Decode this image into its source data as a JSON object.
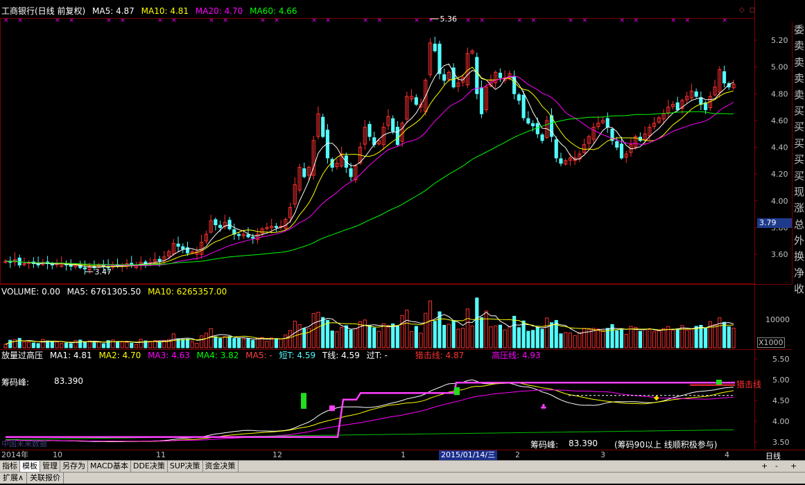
{
  "header": {
    "title": "工商银行(日线 前复权)",
    "ma5": "MA5: 4.87",
    "ma10": "MA10: 4.81",
    "ma20": "MA20: 4.70",
    "ma60": "MA60: 4.66"
  },
  "price_axis": {
    "ticks": [
      "5.20",
      "5.00",
      "4.80",
      "4.60",
      "4.40",
      "4.20",
      "4.00",
      "3.80",
      "3.60"
    ],
    "current_price": "3.79",
    "high_label": "5.36",
    "low_label": "3.47"
  },
  "side_panel": [
    "委",
    "卖",
    "卖",
    "卖",
    "卖",
    "买",
    "买",
    "买",
    "买",
    "买",
    "现",
    "涨",
    "总",
    "外",
    "换",
    "净",
    "收"
  ],
  "volume_panel": {
    "legend": {
      "volume": "VOLUME: 0.00",
      "ma5": "MA5: 6761305.50",
      "ma10": "MA10: 6265357.00"
    },
    "axis_label": "10000",
    "unit": "X1000"
  },
  "indicator_panel": {
    "legend": {
      "name": "放量过高压",
      "ma1": "MA1: 4.81",
      "ma2": "MA2: 4.70",
      "ma3": "MA3: 4.63",
      "ma4": "MA4: 3.82",
      "ma5": "MA5: -",
      "short_t": "短T: 4.59",
      "t_line": "T线: 4.59",
      "pass_t": "过T: -",
      "sniper": "猎击线: 4.87",
      "pressure": "高压线: 4.93"
    },
    "chip_peak_label": "筹码峰:",
    "chip_peak_value": "83.390",
    "chip_peak_bottom_label": "筹码峰:",
    "chip_peak_bottom_value": "83.390",
    "note": "(筹码90以上 线顺积极参与)",
    "sniper_tag": "猎击线",
    "watermark": "中国未来数据",
    "ticks": [
      "5.50",
      "5.00",
      "4.50",
      "4.00",
      "3.50"
    ]
  },
  "time_axis": {
    "labels": [
      "2014年",
      "10",
      "11",
      "12",
      "1",
      "2",
      "3",
      "4"
    ],
    "selected": "2015/01/14/三",
    "period": "日线"
  },
  "tabs": [
    "指标",
    "模板",
    "管理",
    "另存为",
    "MACD基本",
    "DDE决策",
    "SUP决策",
    "资金决策"
  ],
  "tab_controls": [
    "+",
    "-",
    "+"
  ],
  "status": [
    "扩展∧",
    "关联报价"
  ],
  "colors": {
    "up": "#ff3030",
    "down": "#54fcfc",
    "ma5": "#ffffff",
    "ma10": "#ffff00",
    "ma20": "#ff00ff",
    "ma60": "#00ff00",
    "frame": "#7a0000"
  },
  "chart_data": {
    "type": "candlestick",
    "close": [
      3.55,
      3.54,
      3.56,
      3.52,
      3.53,
      3.54,
      3.53,
      3.52,
      3.54,
      3.53,
      3.52,
      3.53,
      3.53,
      3.52,
      3.51,
      3.52,
      3.5,
      3.49,
      3.51,
      3.5,
      3.52,
      3.51,
      3.5,
      3.52,
      3.51,
      3.52,
      3.53,
      3.52,
      3.52,
      3.54,
      3.53,
      3.54,
      3.56,
      3.55,
      3.58,
      3.62,
      3.68,
      3.66,
      3.64,
      3.61,
      3.62,
      3.62,
      3.69,
      3.75,
      3.85,
      3.82,
      3.8,
      3.84,
      3.79,
      3.75,
      3.74,
      3.75,
      3.73,
      3.72,
      3.75,
      3.79,
      3.8,
      3.81,
      3.8,
      3.81,
      3.86,
      3.95,
      4.12,
      4.25,
      4.18,
      4.25,
      4.45,
      4.65,
      4.48,
      4.32,
      4.25,
      4.28,
      4.35,
      4.25,
      4.18,
      4.26,
      4.4,
      4.55,
      4.48,
      4.42,
      4.45,
      4.55,
      4.63,
      4.52,
      4.42,
      4.58,
      4.78,
      4.78,
      4.72,
      4.72,
      4.9,
      5.18,
      5.12,
      4.95,
      4.9,
      4.96,
      4.85,
      4.88,
      4.92,
      5.1,
      5.12,
      4.8,
      4.65,
      4.85,
      4.9,
      4.96,
      4.92,
      4.92,
      4.95,
      4.8,
      4.75,
      4.62,
      4.58,
      4.56,
      4.5,
      4.45,
      4.6,
      4.48,
      4.32,
      4.28,
      4.3,
      4.32,
      4.32,
      4.35,
      4.42,
      4.48,
      4.55,
      4.58,
      4.6,
      4.55,
      4.45,
      4.4,
      4.32,
      4.35,
      4.42,
      4.48,
      4.45,
      4.5,
      4.55,
      4.58,
      4.62,
      4.65,
      4.7,
      4.72,
      4.68,
      4.75,
      4.78,
      4.82,
      4.78,
      4.72,
      4.68,
      4.78,
      4.85,
      4.98,
      4.88,
      4.85,
      4.87
    ]
  }
}
